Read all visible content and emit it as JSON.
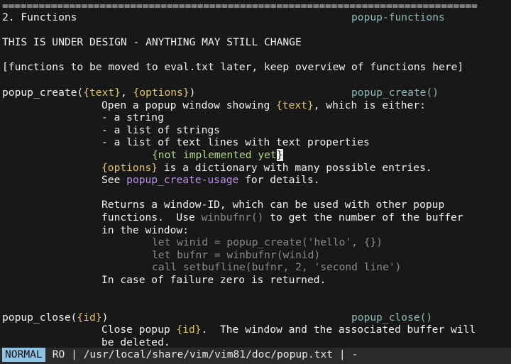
{
  "colors": {
    "background": "#181818",
    "text": "#f0f0f0",
    "arg": "#e0c36a",
    "link": "#b891e6",
    "tag": "#8fb8b8",
    "example": "#8a8a8a",
    "mode_badge": "#8fc3e6"
  },
  "doc": {
    "separator": "==============================================================================",
    "section_title": "2. Functions",
    "section_tag": "popup-functions",
    "warning": "THIS IS UNDER DESIGN - ANYTHING MAY STILL CHANGE",
    "note": "[functions to be moved to eval.txt later, keep overview of functions here]",
    "create": {
      "name": "popup_create(",
      "arg1": "{text}",
      "sep": ", ",
      "arg2": "{options}",
      "close": ")",
      "tag": "popup_create()",
      "desc1_pre": "Open a popup window showing ",
      "desc1_arg": "{text}",
      "desc1_post": ", which is either:",
      "item1": "- a string",
      "item2": "- a list of strings",
      "item3": "- a list of text lines with text properties",
      "not_impl": "{not implemented yet",
      "not_impl_cursor": "}",
      "opts_arg": "{options}",
      "opts_post": " is a dictionary with many possible entries.",
      "see_pre": "See ",
      "see_link": "popup_create-usage",
      "see_post": " for details.",
      "returns": "Returns a window-ID, which can be used with other popup",
      "use_pre": "functions.  Use ",
      "use_fn": "winbufnr()",
      "use_post": " to get the number of the buffer",
      "in_window": "in the window:",
      "ex1": "let winid = popup_create('hello', {})",
      "ex2": "let bufnr = winbufnr(winid)",
      "ex3": "call setbufline(bufnr, 2, 'second line')",
      "failure": "In case of failure zero is returned."
    },
    "close": {
      "name": "popup_close(",
      "arg": "{id}",
      "close": ")",
      "tag": "popup_close()",
      "desc_pre": "Close popup ",
      "desc_arg": "{id}",
      "desc_post": ".  The window and the associated buffer will",
      "desc2": "be deleted."
    }
  },
  "status": {
    "mode": "NORMAL",
    "info": "RO | /usr/local/share/vim/vim81/doc/popup.txt | -"
  }
}
